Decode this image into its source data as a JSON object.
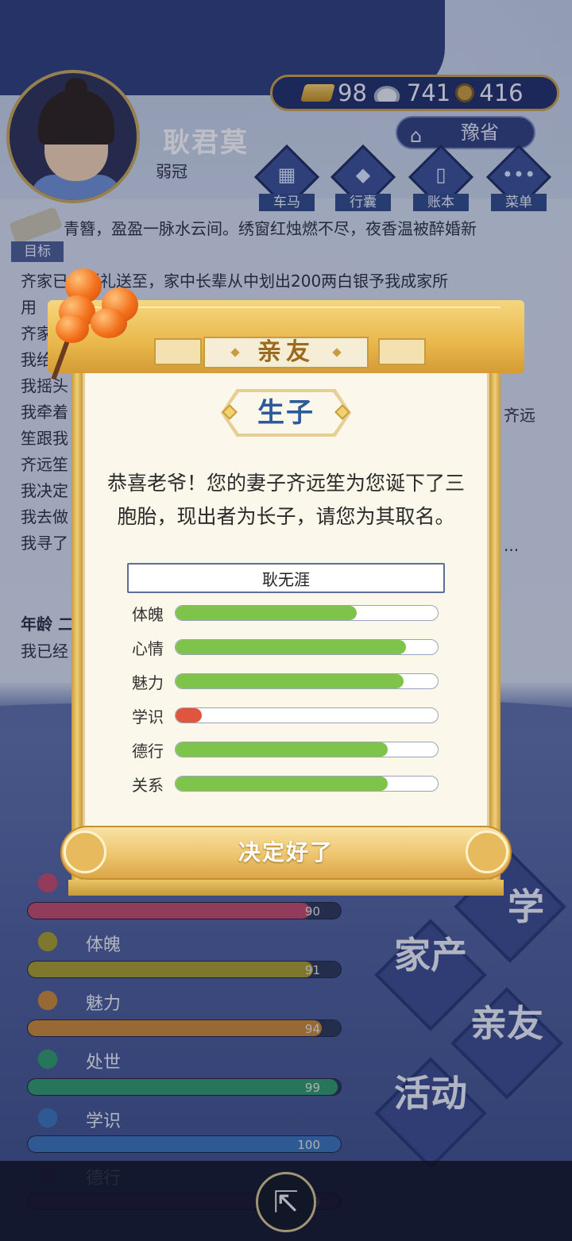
{
  "header": {
    "player_name": "耿君莫",
    "player_age_title": "弱冠",
    "currency": {
      "gold": "98",
      "silver": "741",
      "coins": "416"
    },
    "location": "豫省",
    "nav": [
      {
        "label": "车马",
        "icon": "carriage-icon"
      },
      {
        "label": "行囊",
        "icon": "bag-icon"
      },
      {
        "label": "账本",
        "icon": "ledger-icon"
      },
      {
        "label": "菜单",
        "icon": "menu-icon"
      }
    ]
  },
  "story": {
    "goal_label": "目标",
    "lines": [
      "青簪，盈盈一脉水云间。绣窗红烛燃不尽，夜香温被醉婚新",
      "齐家已将彩礼送至，家中长辈从中划出200两白银予我成家所",
      "用",
      "齐家",
      "我给",
      "我摇头",
      "我牵着",
      "笙跟我",
      "齐远笙",
      "我决定",
      "我去做",
      "我寻了"
    ],
    "right_fragments": [
      "用",
      "齐远",
      "..."
    ],
    "age_line": "年龄 二",
    "last_line": "我已经"
  },
  "bottom_stats": [
    {
      "label": "",
      "value": 90,
      "max": 100,
      "color": "#c2496a",
      "icon": "flower-icon"
    },
    {
      "label": "体魄",
      "value": 91,
      "max": 100,
      "color": "#a89b2b",
      "icon": "body-icon"
    },
    {
      "label": "魅力",
      "value": 94,
      "max": 100,
      "color": "#c98a36",
      "icon": "charm-icon"
    },
    {
      "label": "处世",
      "value": 99,
      "max": 100,
      "color": "#2f9a6b",
      "icon": "shoe-icon"
    },
    {
      "label": "学识",
      "value": 100,
      "max": 100,
      "color": "#3a72b8",
      "icon": "books-icon"
    },
    {
      "label": "德行",
      "value": 99,
      "max": 100,
      "color": "#5a3a8a",
      "icon": "virtue-icon"
    }
  ],
  "side_menu": [
    {
      "label": "学"
    },
    {
      "label": "家产"
    },
    {
      "label": "亲友"
    },
    {
      "label": "活动"
    }
  ],
  "modal": {
    "title": "亲友",
    "subtitle": "生子",
    "message": "恭喜老爷！您的妻子齐远笙为您诞下了三胞胎，现出者为长子，请您为其取名。",
    "name_value": "耿无涯",
    "attributes": [
      {
        "label": "体魄",
        "value": 0.69,
        "color": "#7ec44a"
      },
      {
        "label": "心情",
        "value": 0.88,
        "color": "#7ec44a"
      },
      {
        "label": "魅力",
        "value": 0.87,
        "color": "#7ec44a"
      },
      {
        "label": "学识",
        "value": 0.1,
        "color": "#e0553d"
      },
      {
        "label": "德行",
        "value": 0.81,
        "color": "#7ec44a"
      },
      {
        "label": "关系",
        "value": 0.81,
        "color": "#7ec44a"
      }
    ],
    "confirm_label": "决定好了"
  }
}
